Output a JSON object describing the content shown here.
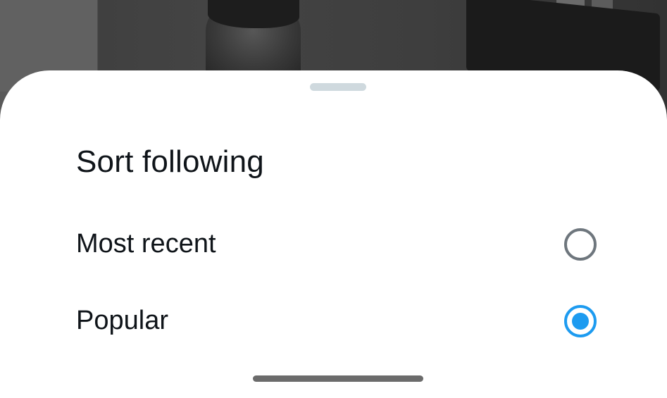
{
  "sheet": {
    "title": "Sort following",
    "options": [
      {
        "label": "Most recent",
        "selected": false
      },
      {
        "label": "Popular",
        "selected": true
      }
    ]
  },
  "colors": {
    "accent": "#1d9bf0",
    "text": "#0f1419",
    "radio_unselected": "#6e767d",
    "grabber": "#cfd9de",
    "sheet_background": "#ffffff"
  }
}
